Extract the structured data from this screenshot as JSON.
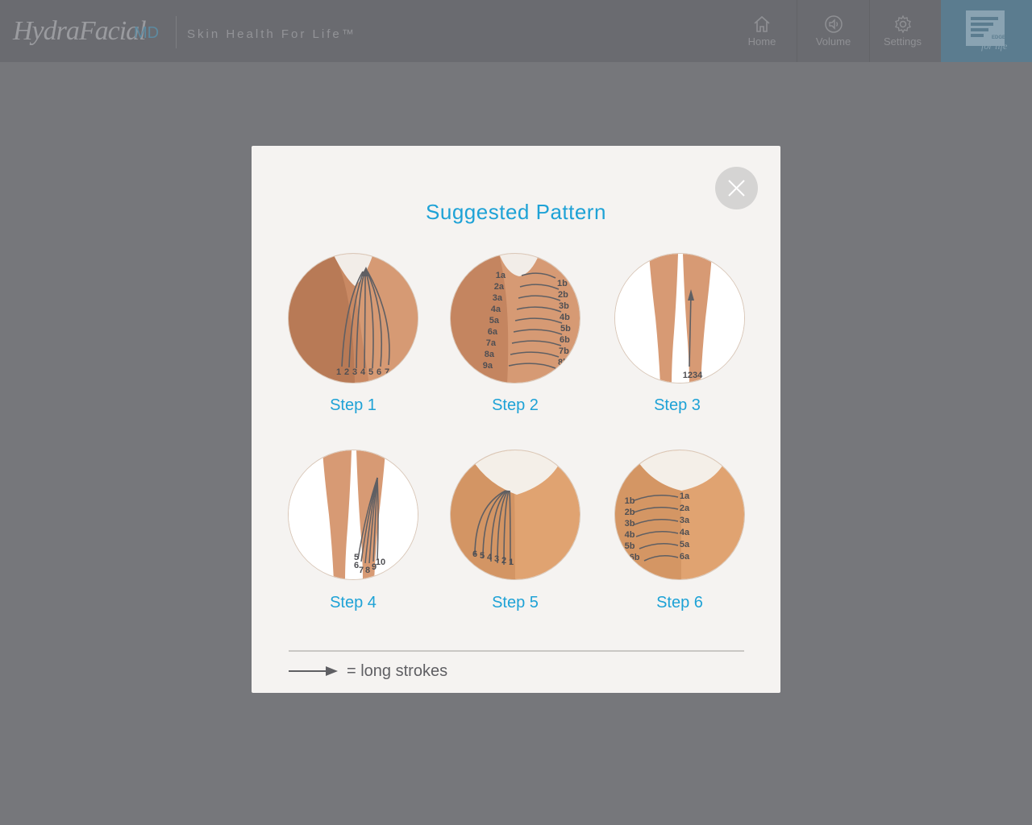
{
  "header": {
    "logo_text": "HydraFacial",
    "logo_suffix": "MD",
    "tagline": "Skin Health For Life™",
    "nav": [
      {
        "label": "Home",
        "icon": "home-icon"
      },
      {
        "label": "Volume",
        "icon": "speaker-icon"
      },
      {
        "label": "Settings",
        "icon": "gear-icon"
      }
    ],
    "brand_script": "for life",
    "brand_badge_text": "EDGE"
  },
  "modal": {
    "title": "Suggested Pattern",
    "close_icon": "close-icon",
    "steps": [
      {
        "label": "Step 1",
        "markers": [
          "1",
          "2",
          "3",
          "4",
          "5",
          "6",
          "7"
        ]
      },
      {
        "label": "Step 2",
        "markers": [
          "1a",
          "2a",
          "3a",
          "4a",
          "5a",
          "6a",
          "7a",
          "8a",
          "9a",
          "1b",
          "2b",
          "3b",
          "4b",
          "5b",
          "6b",
          "7b",
          "8b",
          "9b"
        ]
      },
      {
        "label": "Step 3",
        "markers": [
          "1234"
        ]
      },
      {
        "label": "Step 4",
        "markers": [
          "5",
          "6",
          "7",
          "8",
          "9",
          "10"
        ]
      },
      {
        "label": "Step 5",
        "markers": [
          "6",
          "5",
          "4",
          "3",
          "2",
          "1"
        ]
      },
      {
        "label": "Step 6",
        "markers": [
          "1b",
          "2b",
          "3b",
          "4b",
          "5b",
          "6b",
          "1a",
          "2a",
          "3a",
          "4a",
          "5a",
          "6a"
        ]
      }
    ],
    "legend_text": "= long strokes"
  },
  "colors": {
    "accent": "#1ea2d6",
    "overlay": "#76777b",
    "modal_bg": "#f5f3f1",
    "skin": "#d79a73",
    "arrow": "#5f5f63"
  }
}
